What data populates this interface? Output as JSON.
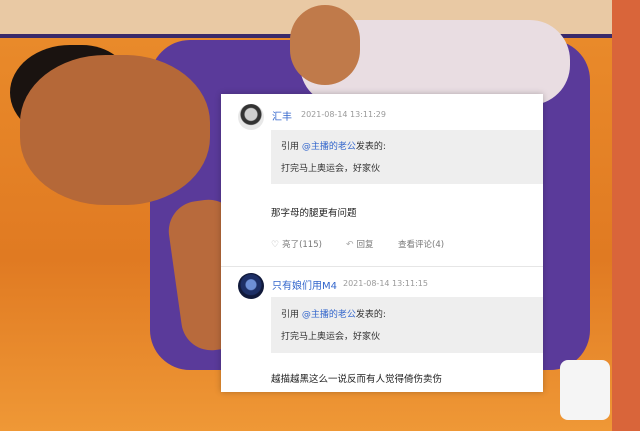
{
  "comments": [
    {
      "username": "汇丰",
      "time": "2021-08-14 13:11:29",
      "quote_prefix": "引用 ",
      "quote_user": "@主播的老公",
      "quote_suffix": "发表的:",
      "quote_text": "打完马上奥运会，好家伙",
      "body": "那字母的腿更有问题",
      "like_label": "亮了(115)",
      "reply_label": "回复",
      "view_label": "查看评论(4)"
    },
    {
      "username": "只有娘们用M4",
      "time": "2021-08-14 13:11:15",
      "quote_prefix": "引用 ",
      "quote_user": "@主播的老公",
      "quote_suffix": "发表的:",
      "quote_text": "打完马上奥运会，好家伙",
      "body": "越描越黑这么一说反而有人觉得倚伤卖伤"
    }
  ],
  "icons": {
    "like": "thumbs-up-icon",
    "reply": "reply-arrow-icon"
  },
  "colors": {
    "link": "#3366cc",
    "quote_bg": "#eeeeee",
    "court": "#e07a22"
  }
}
